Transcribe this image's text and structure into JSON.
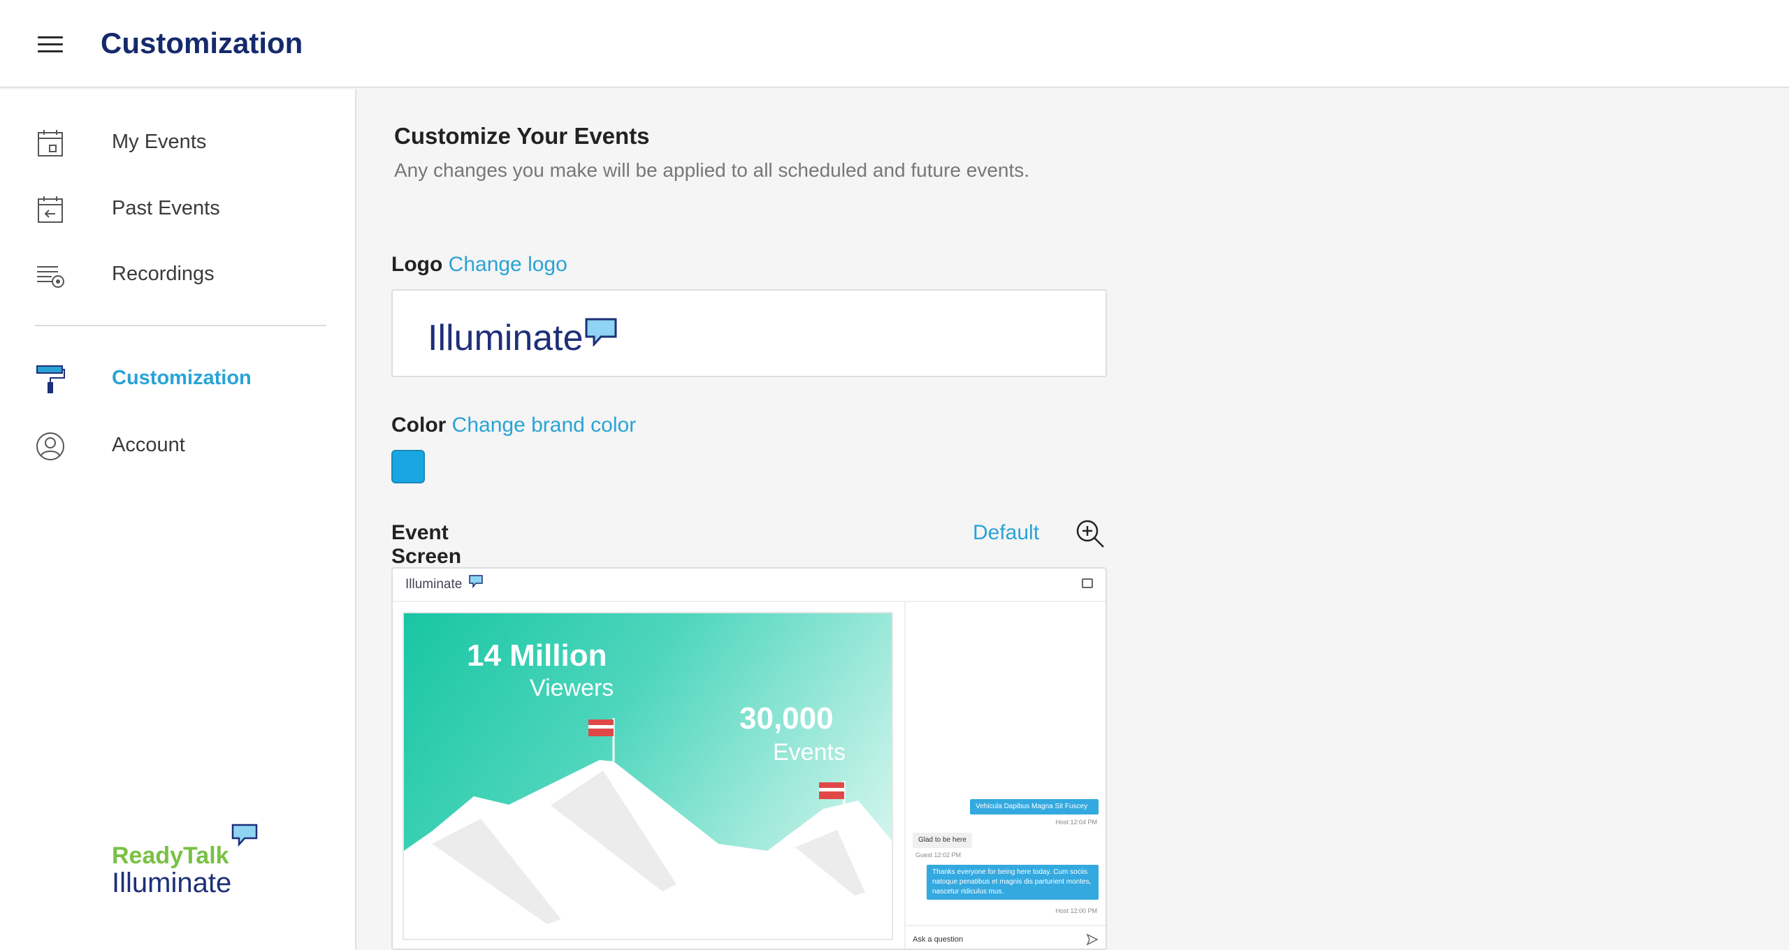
{
  "header": {
    "title": "Customization"
  },
  "sidebar": {
    "items": [
      {
        "label": "My Events",
        "icon": "calendar-icon"
      },
      {
        "label": "Past Events",
        "icon": "calendar-back-icon"
      },
      {
        "label": "Recordings",
        "icon": "recordings-icon"
      },
      {
        "label": "Customization",
        "icon": "paint-roller-icon",
        "active": true
      },
      {
        "label": "Account",
        "icon": "user-circle-icon"
      }
    ],
    "brand": {
      "line1": "ReadyTalk",
      "line2": "Illuminate"
    }
  },
  "main": {
    "title": "Customize Your Events",
    "subtitle": "Any changes you make will be applied to all scheduled and future events.",
    "logo": {
      "label": "Logo",
      "link": "Change logo",
      "wordmark": "Illuminate"
    },
    "color": {
      "label": "Color",
      "link": "Change brand color",
      "value": "#1aa7e1"
    },
    "event_screen": {
      "label": "Event Screen",
      "default_link": "Default",
      "preview": {
        "brand": "Illuminate",
        "slide": {
          "stat1": "14 Million",
          "stat1_label": "Viewers",
          "stat2": "30,000",
          "stat2_label": "Events"
        },
        "chat": {
          "messages": [
            {
              "text": "Vehicula Dapibus Magna Sit Fuscey",
              "meta": "Host 12:04 PM",
              "role": "host"
            },
            {
              "text": "Glad to be here",
              "meta": "Guest 12:02 PM",
              "role": "guest"
            },
            {
              "text": "Thanks everyone for being here today. Cum sociis natoque penatibus et magnis dis parturient montes, nascetur ridiculus mus.",
              "meta": "Host 12:00 PM",
              "role": "host"
            }
          ],
          "placeholder": "Ask a question"
        }
      }
    }
  },
  "colors": {
    "accent": "#29a3d6",
    "title": "#152a6b",
    "brand_green": "#7ac143"
  }
}
